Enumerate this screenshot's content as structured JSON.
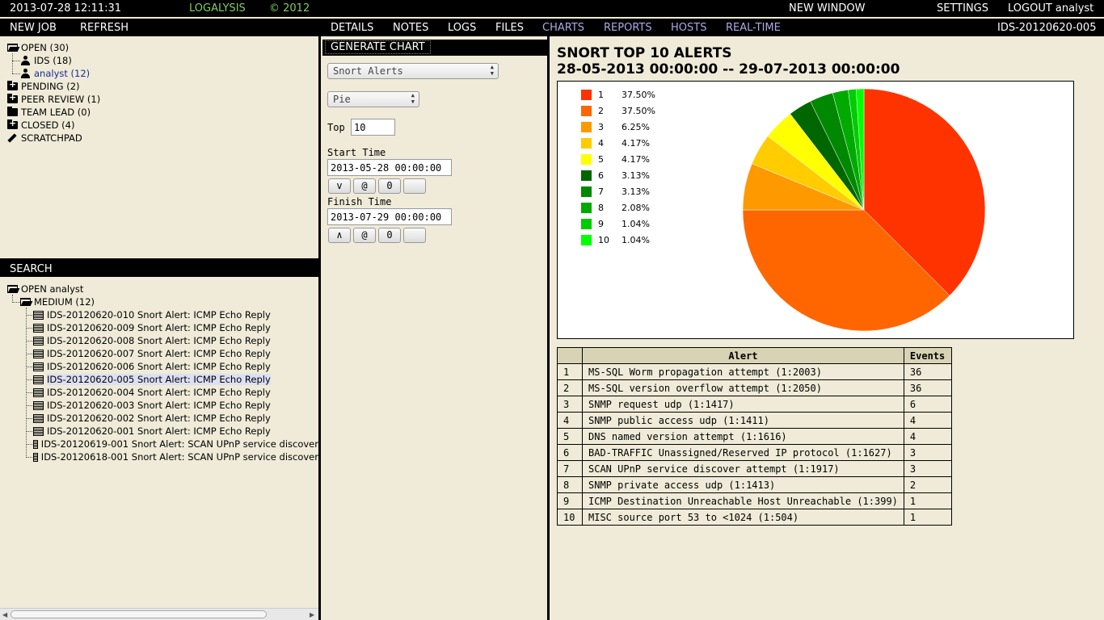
{
  "topbar": {
    "datetime": "2013-07-28 12:11:31",
    "app_name": "LOGALYSIS",
    "copyright": "© 2012",
    "new_window": "NEW WINDOW",
    "settings": "SETTINGS",
    "logout": "LOGOUT analyst"
  },
  "leftmenu": {
    "new_job": "NEW JOB",
    "refresh": "REFRESH"
  },
  "tabs": {
    "details": "DETAILS",
    "notes": "NOTES",
    "logs": "LOGS",
    "files": "FILES",
    "charts": "CHARTS",
    "reports": "REPORTS",
    "hosts": "HOSTS",
    "realtime": "REAL-TIME",
    "job_id": "IDS-20120620-005"
  },
  "tree": {
    "open": "OPEN (30)",
    "ids": "IDS (18)",
    "analyst": "analyst (12)",
    "pending": "PENDING (2)",
    "peer_review": "PEER REVIEW (1)",
    "team_lead": "TEAM LEAD (0)",
    "closed": "CLOSED (4)",
    "scratchpad": "SCRATCHPAD"
  },
  "search": {
    "title": "SEARCH",
    "open_analyst": "OPEN analyst",
    "medium": "MEDIUM (12)",
    "results": [
      "IDS-20120620-010 Snort Alert: ICMP Echo Reply",
      "IDS-20120620-009 Snort Alert: ICMP Echo Reply",
      "IDS-20120620-008 Snort Alert: ICMP Echo Reply",
      "IDS-20120620-007 Snort Alert: ICMP Echo Reply",
      "IDS-20120620-006 Snort Alert: ICMP Echo Reply",
      "IDS-20120620-005 Snort Alert: ICMP Echo Reply",
      "IDS-20120620-004 Snort Alert: ICMP Echo Reply",
      "IDS-20120620-003 Snort Alert: ICMP Echo Reply",
      "IDS-20120620-002 Snort Alert: ICMP Echo Reply",
      "IDS-20120620-001 Snort Alert: ICMP Echo Reply",
      "IDS-20120619-001 Snort Alert: SCAN UPnP service discover",
      "IDS-20120618-001 Snort Alert: SCAN UPnP service discover"
    ],
    "selected_index": 5
  },
  "form": {
    "generate": "GENERATE CHART",
    "source": "Snort Alerts",
    "chart_type": "Pie",
    "top_label": "Top",
    "top_value": "10",
    "start_label": "Start Time",
    "start_value": "2013-05-28 00:00:00",
    "finish_label": "Finish Time",
    "finish_value": "2013-07-29 00:00:00",
    "start_buttons": [
      "v",
      "@",
      "0",
      ""
    ],
    "finish_buttons": [
      "∧",
      "@",
      "0",
      ""
    ]
  },
  "chart_header": {
    "title": "SNORT TOP 10 ALERTS",
    "range": "28-05-2013 00:00:00 -- 29-07-2013 00:00:00"
  },
  "chart_data": {
    "type": "pie",
    "title": "SNORT TOP 10 ALERTS",
    "categories": [
      "1",
      "2",
      "3",
      "4",
      "5",
      "6",
      "7",
      "8",
      "9",
      "10"
    ],
    "values": [
      36,
      36,
      6,
      4,
      4,
      3,
      3,
      2,
      1,
      1
    ],
    "percent_labels": [
      "37.50%",
      "37.50%",
      "6.25%",
      "4.17%",
      "4.17%",
      "3.13%",
      "3.13%",
      "2.08%",
      "1.04%",
      "1.04%"
    ],
    "colors": [
      "#ff3300",
      "#ff6600",
      "#ff9900",
      "#ffcc00",
      "#ffff00",
      "#006600",
      "#008800",
      "#00aa00",
      "#00cc00",
      "#00ff00"
    ],
    "legend_position": "top-left"
  },
  "table": {
    "headers": [
      "",
      "Alert",
      "Events"
    ],
    "rows": [
      [
        "1",
        "MS-SQL Worm propagation attempt (1:2003)",
        "36"
      ],
      [
        "2",
        "MS-SQL version overflow attempt (1:2050)",
        "36"
      ],
      [
        "3",
        "SNMP request udp (1:1417)",
        "6"
      ],
      [
        "4",
        "SNMP public access udp (1:1411)",
        "4"
      ],
      [
        "5",
        "DNS named version attempt (1:1616)",
        "4"
      ],
      [
        "6",
        "BAD-TRAFFIC Unassigned/Reserved IP protocol (1:1627)",
        "3"
      ],
      [
        "7",
        "SCAN UPnP service discover attempt (1:1917)",
        "3"
      ],
      [
        "8",
        "SNMP private access udp (1:1413)",
        "2"
      ],
      [
        "9",
        "ICMP Destination Unreachable Host Unreachable (1:399)",
        "1"
      ],
      [
        "10",
        "MISC source port 53 to <1024 (1:504)",
        "1"
      ]
    ]
  }
}
